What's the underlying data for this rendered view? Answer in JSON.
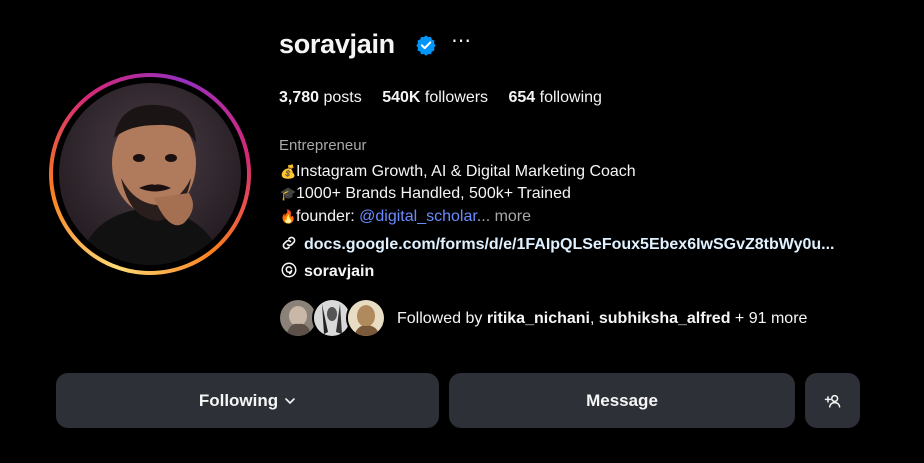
{
  "profile": {
    "username": "soravjain",
    "more_label": "⋯",
    "stats": {
      "posts_count": "3,780",
      "posts_label": "posts",
      "followers_count": "540K",
      "followers_label": "followers",
      "following_count": "654",
      "following_label": "following"
    },
    "category": "Entrepreneur",
    "bio": [
      {
        "emoji": "💰",
        "text": "Instagram Growth, AI & Digital Marketing Coach"
      },
      {
        "emoji": "🎓",
        "text": "1000+ Brands Handled, 500k+ Trained"
      },
      {
        "emoji": "🔥",
        "text": "founder: ",
        "mention": "@digital_scholar",
        "more": "... more"
      }
    ],
    "link": "docs.google.com/forms/d/e/1FAIpQLSeFoux5Ebex6IwSGvZ8tbWy0u...",
    "threads_handle": "soravjain",
    "followed_by": {
      "prefix": "Followed by ",
      "user1": "ritika_nichani",
      "separator": ", ",
      "user2": "subhiksha_alfred",
      "suffix": " + 91 more"
    }
  },
  "actions": {
    "following_label": "Following",
    "message_label": "Message"
  },
  "colors": {
    "background": "#000000",
    "button_bg": "#2d3036",
    "verified": "#0095f6",
    "mention": "#6b8cff",
    "muted_text": "#a8a8a8"
  },
  "icons": [
    "verified-badge-icon",
    "more-options-icon",
    "link-icon",
    "threads-icon",
    "chevron-down-icon",
    "add-user-icon"
  ]
}
